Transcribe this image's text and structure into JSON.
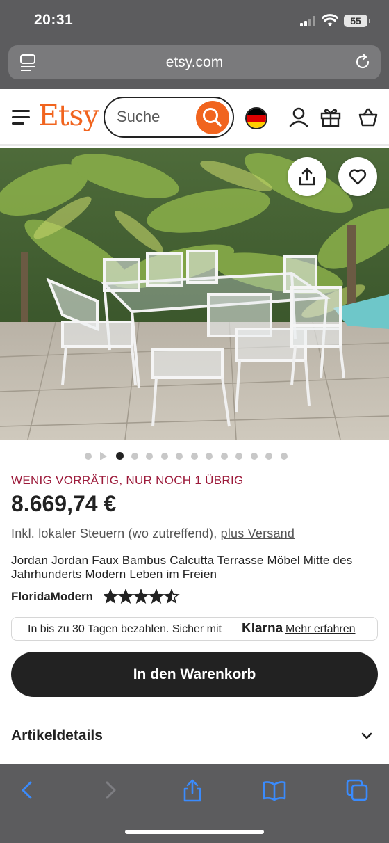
{
  "status_bar": {
    "time": "20:31",
    "battery": "55"
  },
  "browser": {
    "url": "etsy.com"
  },
  "header": {
    "logo": "Etsy",
    "search_placeholder": "Suche"
  },
  "product": {
    "stock_notice": "WENIG VORRÄTIG, NUR NOCH 1 ÜBRIG",
    "price": "8.669,74 €",
    "tax_note": "Inkl. lokaler Steuern (wo zutreffend), ",
    "shipping_link": "plus Versand",
    "title": "Jordan Jordan Faux Bambus Calcutta Terrasse Möbel Mitte des Jahrhunderts Modern Leben im Freien",
    "shop_name": "FloridaModern",
    "rating": 4.5,
    "image_count": 13,
    "active_image": 1
  },
  "klarna": {
    "text": "In bis zu 30 Tagen bezahlen. Sicher mit",
    "brand": "Klarna",
    "link": "Mehr erfahren"
  },
  "cart_button": "In den Warenkorb",
  "details_section": "Artikeldetails",
  "colors": {
    "etsy_orange": "#f1641e",
    "stock_red": "#9c1a3a",
    "dark": "#222222",
    "ios_blue": "#3a8bfd"
  }
}
